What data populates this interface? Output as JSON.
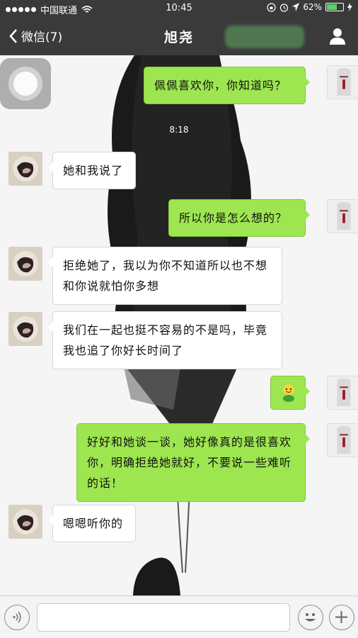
{
  "status_bar": {
    "carrier": "中国联通",
    "time": "10:45",
    "battery_text": "62%",
    "battery_level": 0.62,
    "signal_bars": 5,
    "icons": [
      "signal-dots-icon",
      "wifi-icon",
      "lock-rotation-icon",
      "alarm-icon",
      "location-icon",
      "battery-icon",
      "charging-icon"
    ]
  },
  "header": {
    "back_label": "微信(7)",
    "title": "旭尧",
    "icons": [
      "chevron-left-icon",
      "person-icon"
    ]
  },
  "chat": {
    "timestamp": "8:18",
    "messages": [
      {
        "side": "out",
        "text": "佩佩喜欢你，你知道吗？"
      },
      {
        "side": "in",
        "text": "她和我说了"
      },
      {
        "side": "out",
        "text": "所以你是怎么想的？"
      },
      {
        "side": "in",
        "text": "拒绝她了，我以为你不知道所以也不想和你说就怕你多想"
      },
      {
        "side": "in",
        "text": "我们在一起也挺不容易的不是吗，毕竟我也追了你好长时间了"
      },
      {
        "side": "out",
        "text": "",
        "sticker": "smiley-sticker-icon"
      },
      {
        "side": "out",
        "text": "好好和她谈一谈，她好像真的是很喜欢你，明确拒绝她就好，不要说一些难听的话！"
      },
      {
        "side": "in",
        "text": "嗯嗯听你的"
      }
    ]
  },
  "input_bar": {
    "icons": [
      "voice-icon",
      "emoji-icon",
      "plus-icon"
    ],
    "value": ""
  },
  "colors": {
    "bar_bg": "#3a3a3a",
    "outgoing_bubble": "#9de650",
    "incoming_bubble": "#ffffff",
    "battery_fill": "#4cd964"
  }
}
